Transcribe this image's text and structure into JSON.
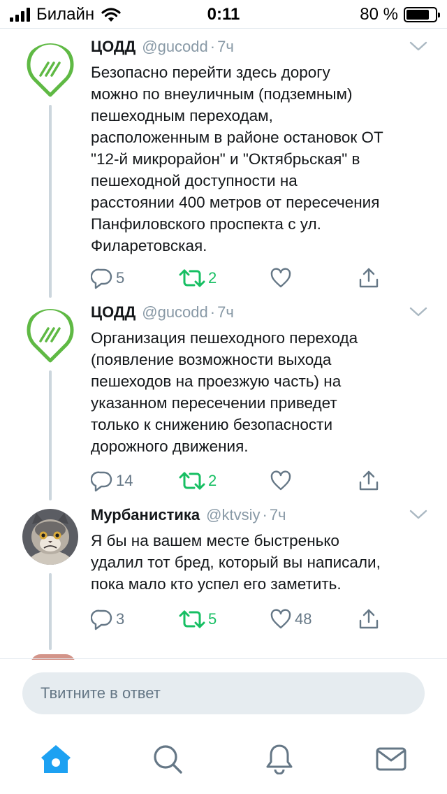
{
  "status_bar": {
    "carrier": "Билайн",
    "time": "0:11",
    "battery_percent": "80 %",
    "battery_level": 0.8,
    "wifi_icon": "wifi-icon",
    "signal_icon": "signal-bars-icon"
  },
  "tweets": [
    {
      "name": "ЦОДД",
      "handle": "@gucodd",
      "separator": "·",
      "time_ago": "7ч",
      "text": "Безопасно перейти здесь дорогу\nможно по внеуличным (подземным)\nпешеходным переходам,\nрасположенным в районе остановок ОТ\n\"12-й микрорайон\" и \"Октябрьская\" в\nпешеходной доступности на\nрасстоянии 400 метров от пересечения\nПанфиловского проспекта с ул.\nФиларетовская.",
      "replies": "5",
      "retweets": "2",
      "likes": ""
    },
    {
      "name": "ЦОДД",
      "handle": "@gucodd",
      "separator": "·",
      "time_ago": "7ч",
      "text": "Организация пешеходного перехода\n(появление возможности выхода\nпешеходов на проезжую часть) на\nуказанном пересечении приведет\nтолько к снижению безопасности\nдорожного движения.",
      "replies": "14",
      "retweets": "2",
      "likes": ""
    },
    {
      "name": "Мурбанистика",
      "handle": "@ktvsiy",
      "separator": "·",
      "time_ago": "7ч",
      "text": "Я бы на вашем месте быстренько\nудалил тот бред, который вы написали,\nпока мало кто успел его заметить.",
      "replies": "3",
      "retweets": "5",
      "likes": "48"
    }
  ],
  "compose": {
    "placeholder": "Твитните в ответ"
  },
  "tab_bar": {
    "items": [
      "home-icon",
      "search-icon",
      "notifications-bell-icon",
      "messages-envelope-icon"
    ]
  },
  "colors": {
    "accent": "#1da1f2",
    "retweet_green": "#17bf63",
    "text_primary": "#14171a",
    "text_secondary": "#657786",
    "codd_logo_green": "#5fb944"
  }
}
